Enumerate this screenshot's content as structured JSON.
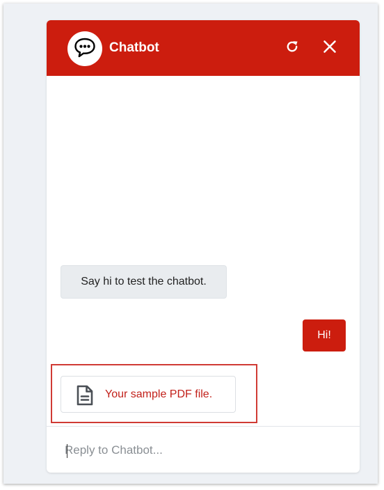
{
  "header": {
    "title": "Chatbot",
    "icons": {
      "avatar": "speech-bubble-icon",
      "refresh": "refresh-icon",
      "close": "close-icon"
    }
  },
  "messages": [
    {
      "from": "bot",
      "text": "Say hi to test the chatbot."
    },
    {
      "from": "user",
      "text": "Hi!"
    }
  ],
  "attachment": {
    "icon": "document-icon",
    "label": "Your sample PDF file."
  },
  "reply": {
    "placeholder": "Reply to Chatbot..."
  },
  "colors": {
    "brand": "#cc1d0e",
    "highlight_border": "#d03a34",
    "bot_bubble": "#e9ecef",
    "link": "#c2201a"
  }
}
